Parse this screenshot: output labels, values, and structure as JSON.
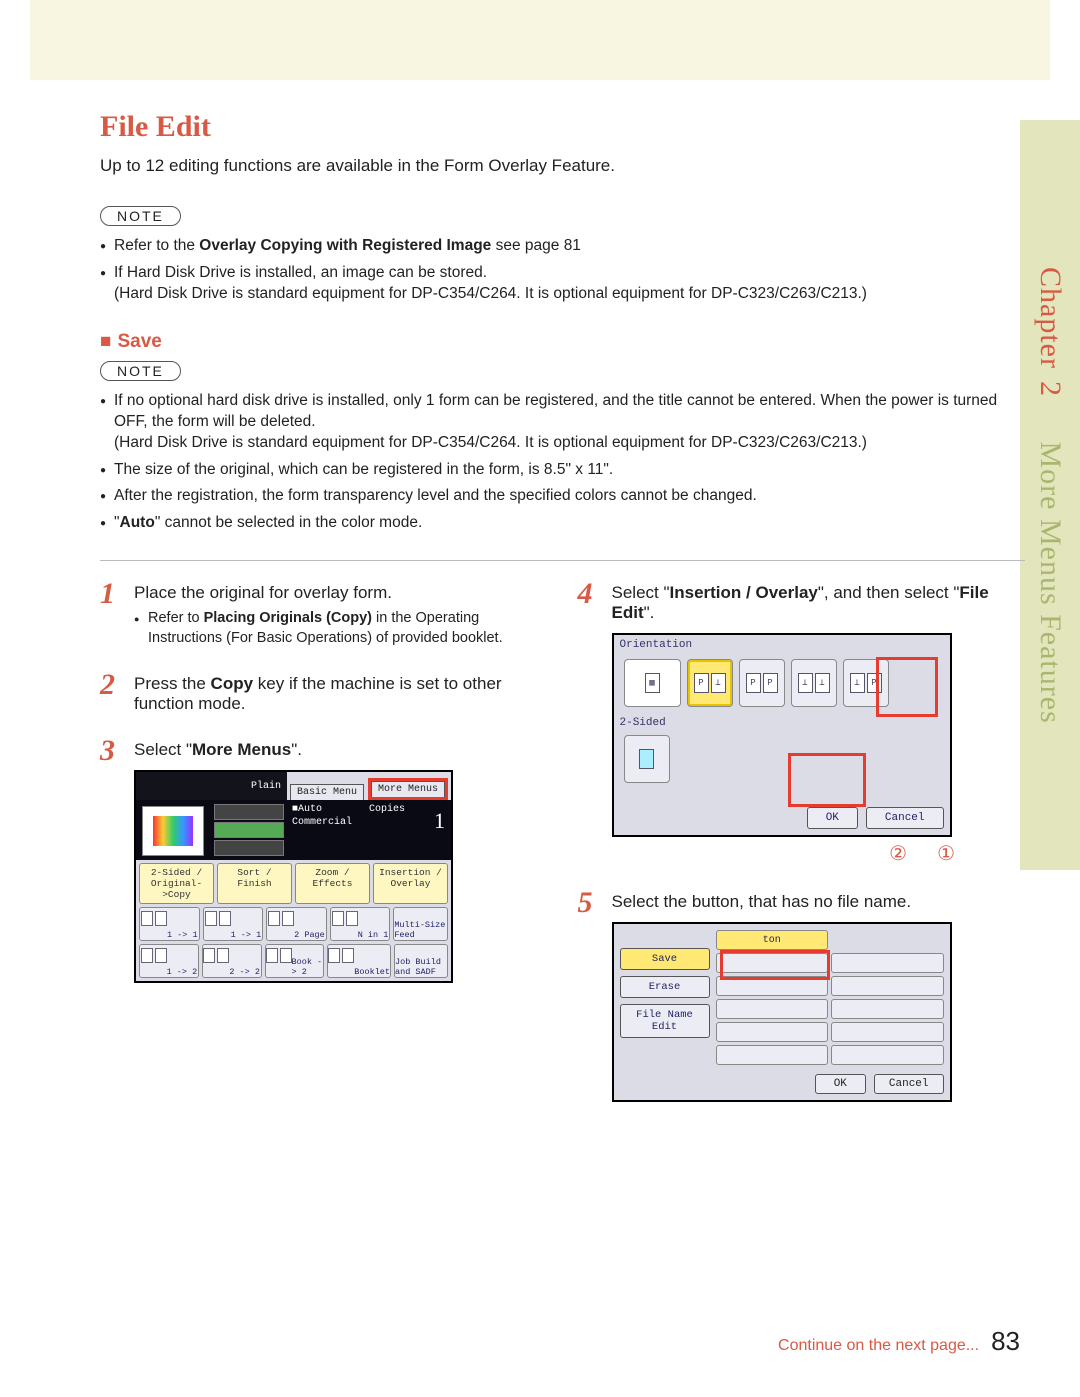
{
  "sidebar": {
    "chapter_label": "Chapter",
    "chapter_num": "2",
    "section": "More Menus Features"
  },
  "title": "File Edit",
  "intro": "Up to 12 editing functions are available in the Form Overlay Feature.",
  "note_label": "NOTE",
  "notes1": [
    {
      "pre": "Refer to the ",
      "bold": "Overlay Copying with Registered Image",
      "post": " see page 81"
    },
    {
      "text": "If Hard Disk Drive is installed, an image can be stored.",
      "sub": "(Hard Disk Drive is standard equipment for DP-C354/C264. It is optional equipment for DP-C323/C263/C213.)"
    }
  ],
  "save_heading": "Save",
  "notes2": [
    {
      "text": "If no optional hard disk drive is installed, only 1 form can be registered, and the title cannot be entered. When the power is turned OFF, the form will be deleted.",
      "sub": "(Hard Disk Drive is standard equipment for DP-C354/C264. It is optional equipment for DP-C323/C263/C213.)"
    },
    {
      "text": "The size of the original, which can be registered in the form, is 8.5\" x 11\"."
    },
    {
      "text": "After the registration, the form transparency level and the specified colors cannot be changed."
    },
    {
      "pre": "\"",
      "bold": "Auto",
      "post": "\" cannot be selected in the color mode."
    }
  ],
  "steps": {
    "s1": {
      "text": "Place the original for overlay form.",
      "sub_pre": "Refer to ",
      "sub_bold": "Placing Originals (Copy)",
      "sub_post": " in the Operating Instructions (For Basic Operations) of provided booklet."
    },
    "s2": {
      "pre": "Press the ",
      "bold": "Copy",
      "post": " key if the machine is set to other function mode."
    },
    "s3": {
      "pre": "Select \"",
      "bold": "More Menus",
      "post": "\"."
    },
    "s4": {
      "pre": "Select \"",
      "bold": "Insertion / Overlay",
      "mid": "\", and then select \"",
      "bold2": "File Edit",
      "post": "\"."
    },
    "s5": {
      "text": "Select the button, that has no file name."
    }
  },
  "shot3": {
    "hdr_text": "Plain",
    "tab_basic": "Basic Menu",
    "tab_more": "More Menus",
    "info_auto": "Auto",
    "info_copies": "Copies",
    "info_commercial": "Commercial",
    "copies_val": "1",
    "row1": [
      "2-Sided / Original->Copy",
      "Sort / Finish",
      "Zoom / Effects",
      "Insertion / Overlay"
    ],
    "icons1": [
      "1 -> 1",
      "1 -> 1",
      "2 Page",
      "N in 1",
      "Multi-Size Feed"
    ],
    "icons2": [
      "1 -> 2",
      "2 -> 2",
      "Book -> 2",
      "Booklet",
      "Job Build and SADF"
    ]
  },
  "shot4": {
    "orientation": "Orientation",
    "two_sided": "2-Sided",
    "ok": "OK",
    "cancel": "Cancel",
    "call1": "②",
    "call2": "①"
  },
  "shot5": {
    "btn_save": "Save",
    "btn_erase": "Erase",
    "btn_file": "File Name Edit",
    "hdr": "ton",
    "ok": "OK",
    "cancel": "Cancel"
  },
  "footer": {
    "cont": "Continue on the next page...",
    "page": "83"
  }
}
